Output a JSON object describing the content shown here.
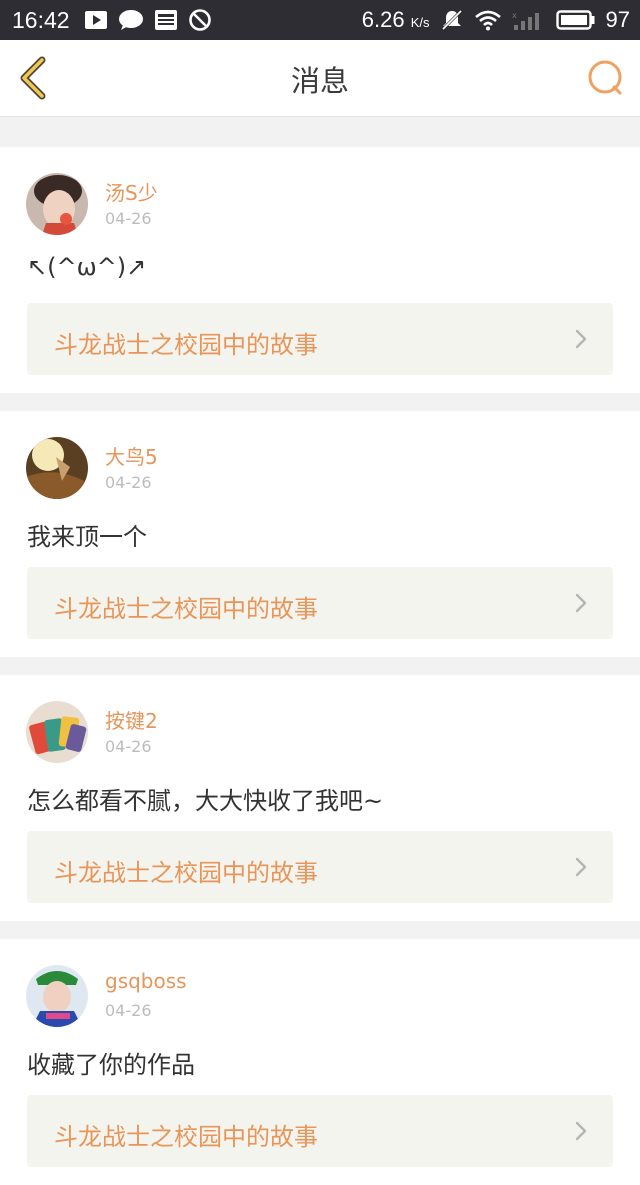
{
  "status_bar": {
    "time": "16:42",
    "net_speed": "6.26",
    "net_unit": "K/s",
    "battery": "97",
    "icons": [
      "video-icon",
      "chat-icon",
      "news-icon",
      "block-icon",
      "mute-icon",
      "wifi-icon",
      "signal-icon",
      "battery-icon"
    ]
  },
  "header": {
    "title": "消息",
    "back_icon": "chevron-left-icon",
    "search_icon": "search-icon",
    "accent_color": "#e8955a"
  },
  "messages": [
    {
      "username": "汤S少",
      "date": "04-26",
      "text": "↖(^ω^)↗",
      "story_title": "斗龙战士之校园中的故事"
    },
    {
      "username": "大鸟5",
      "date": "04-26",
      "text": "我来顶一个",
      "story_title": "斗龙战士之校园中的故事"
    },
    {
      "username": "按键2",
      "date": "04-26",
      "text": "怎么都看不腻，大大快收了我吧~",
      "story_title": "斗龙战士之校园中的故事"
    },
    {
      "username": "gsqboss",
      "date": "04-26",
      "text": "收藏了你的作品",
      "story_title": "斗龙战士之校园中的故事"
    }
  ]
}
